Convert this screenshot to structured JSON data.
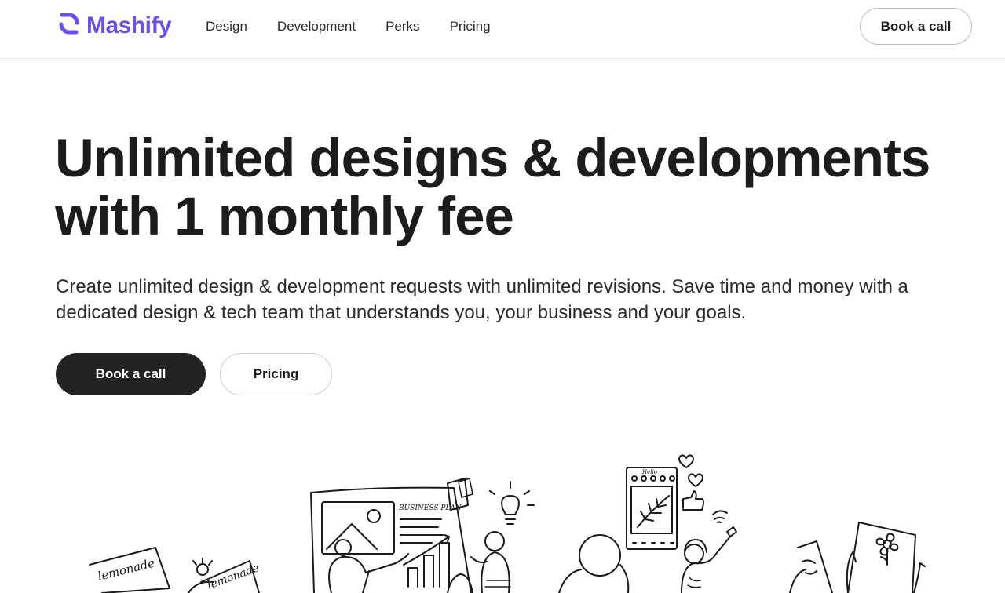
{
  "brand": {
    "name": "Mashify",
    "color": "#6b4df0"
  },
  "nav": {
    "items": [
      "Design",
      "Development",
      "Perks",
      "Pricing"
    ],
    "cta_label": "Book a call"
  },
  "hero": {
    "title_line1": "Unlimited designs & developments",
    "title_line2": "with 1 monthly fee",
    "subtitle": "Create unlimited design & development requests with unlimited revisions. Save time and money with a dedicated design & tech team that understands you, your business and your goals.",
    "primary_cta": "Book a call",
    "secondary_cta": "Pricing"
  },
  "illustration": {
    "sign_left": "lemonade",
    "sign_right": "lemonade",
    "board_title": "BUSINESS PLAN",
    "phone_title": "Hello"
  },
  "colors": {
    "primary_button_bg": "#232323",
    "text": "#1f1f1f"
  }
}
